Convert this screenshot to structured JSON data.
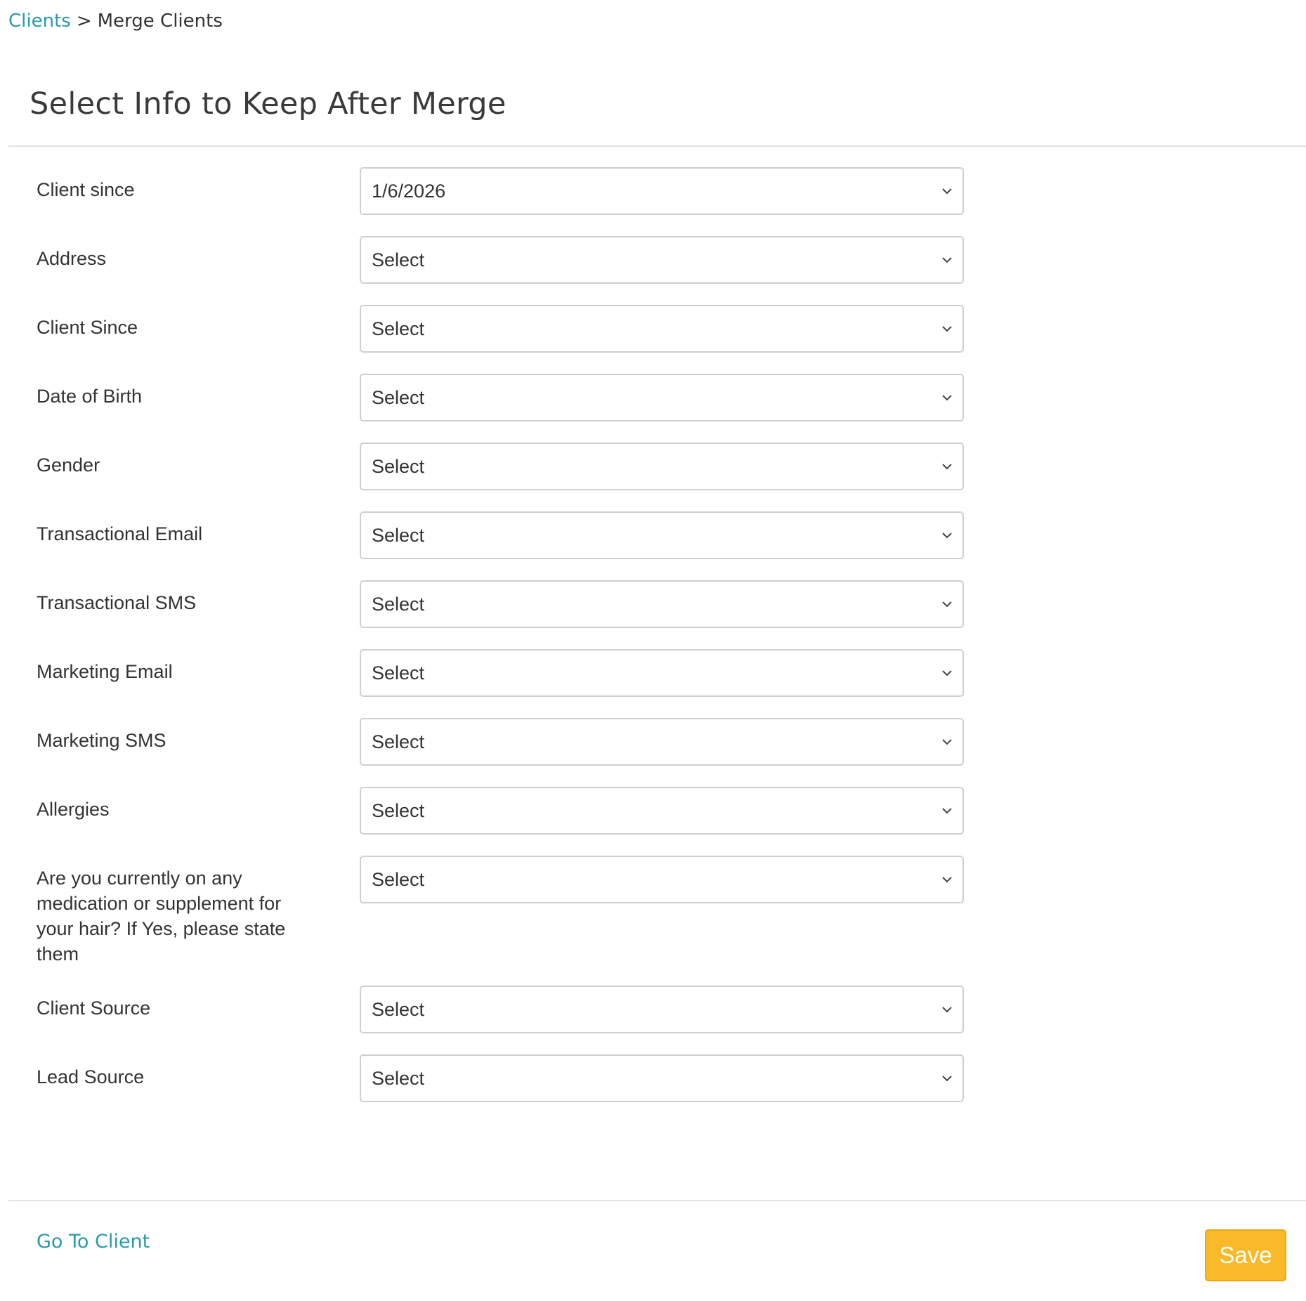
{
  "breadcrumb": {
    "parent": "Clients",
    "separator": ">",
    "current": "Merge Clients"
  },
  "page_title": "Select Info to Keep After Merge",
  "fields": [
    {
      "label": "Client since",
      "value": "1/6/2026"
    },
    {
      "label": "Address",
      "value": "Select"
    },
    {
      "label": "Client Since",
      "value": "Select"
    },
    {
      "label": "Date of Birth",
      "value": "Select"
    },
    {
      "label": "Gender",
      "value": "Select"
    },
    {
      "label": "Transactional Email",
      "value": "Select"
    },
    {
      "label": "Transactional SMS",
      "value": "Select"
    },
    {
      "label": "Marketing Email",
      "value": "Select"
    },
    {
      "label": "Marketing SMS",
      "value": "Select"
    },
    {
      "label": "Allergies",
      "value": "Select"
    },
    {
      "label": "Are you currently on any medication or supplement for your hair? If Yes, please state them",
      "value": "Select"
    },
    {
      "label": "Client Source",
      "value": "Select"
    },
    {
      "label": "Lead Source",
      "value": "Select"
    }
  ],
  "footer": {
    "go_to_client_label": "Go To Client",
    "save_label": "Save"
  },
  "icons": {
    "select_arrow": "chevron-down-icon"
  },
  "colors": {
    "link": "#2a9aaa",
    "save_button": "#f9b928"
  }
}
